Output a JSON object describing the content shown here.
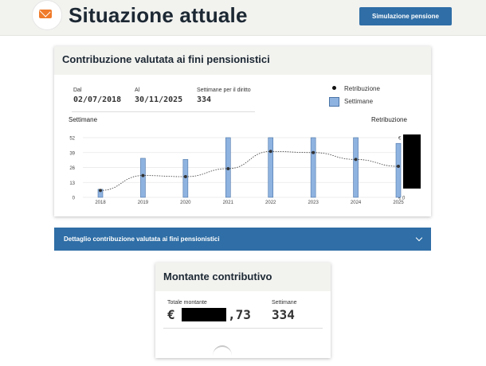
{
  "header": {
    "title": "Situazione attuale",
    "simulate_button": "Simulazione pensione"
  },
  "contrib_card": {
    "title": "Contribuzione valutata ai fini pensionistici",
    "from_label": "Dal",
    "from_value": "02/07/2018",
    "to_label": "Al",
    "to_value": "30/11/2025",
    "weeks_label": "Settimane per il diritto",
    "weeks_value": "334",
    "legend_pay": "Retribuzione",
    "legend_weeks": "Settimane",
    "left_axis_title": "Settimane",
    "right_axis_title": "Retribuzione"
  },
  "chart_data": {
    "type": "bar",
    "categories": [
      "2018",
      "2019",
      "2020",
      "2021",
      "2022",
      "2023",
      "2024",
      "2025"
    ],
    "series": [
      {
        "name": "Settimane",
        "values": [
          7,
          34,
          33,
          52,
          52,
          52,
          52,
          47
        ]
      },
      {
        "name": "Retribuzione",
        "values": [
          6,
          19,
          18,
          25,
          40,
          39,
          33,
          27
        ]
      }
    ],
    "yticks_left": [
      "0",
      "13",
      "26",
      "39",
      "52"
    ],
    "ylim": [
      0,
      52
    ],
    "yticks_right": [
      "€ 0",
      "€",
      "€",
      "€",
      "€"
    ],
    "colors": {
      "bar": "#8fb3e0",
      "bar_border": "#4a74a8",
      "line": "#333333"
    }
  },
  "detail_accordion": {
    "label": "Dettaglio contribuzione valutata ai fini pensionistici"
  },
  "montante_card": {
    "title": "Montante contributivo",
    "total_label": "Totale montante",
    "currency": "€",
    "decimals": ",73",
    "weeks_label": "Settimane",
    "weeks_value": "334"
  },
  "icons": {
    "header_icon": "mail-icon",
    "accordion_icon": "chevron-down-icon"
  }
}
